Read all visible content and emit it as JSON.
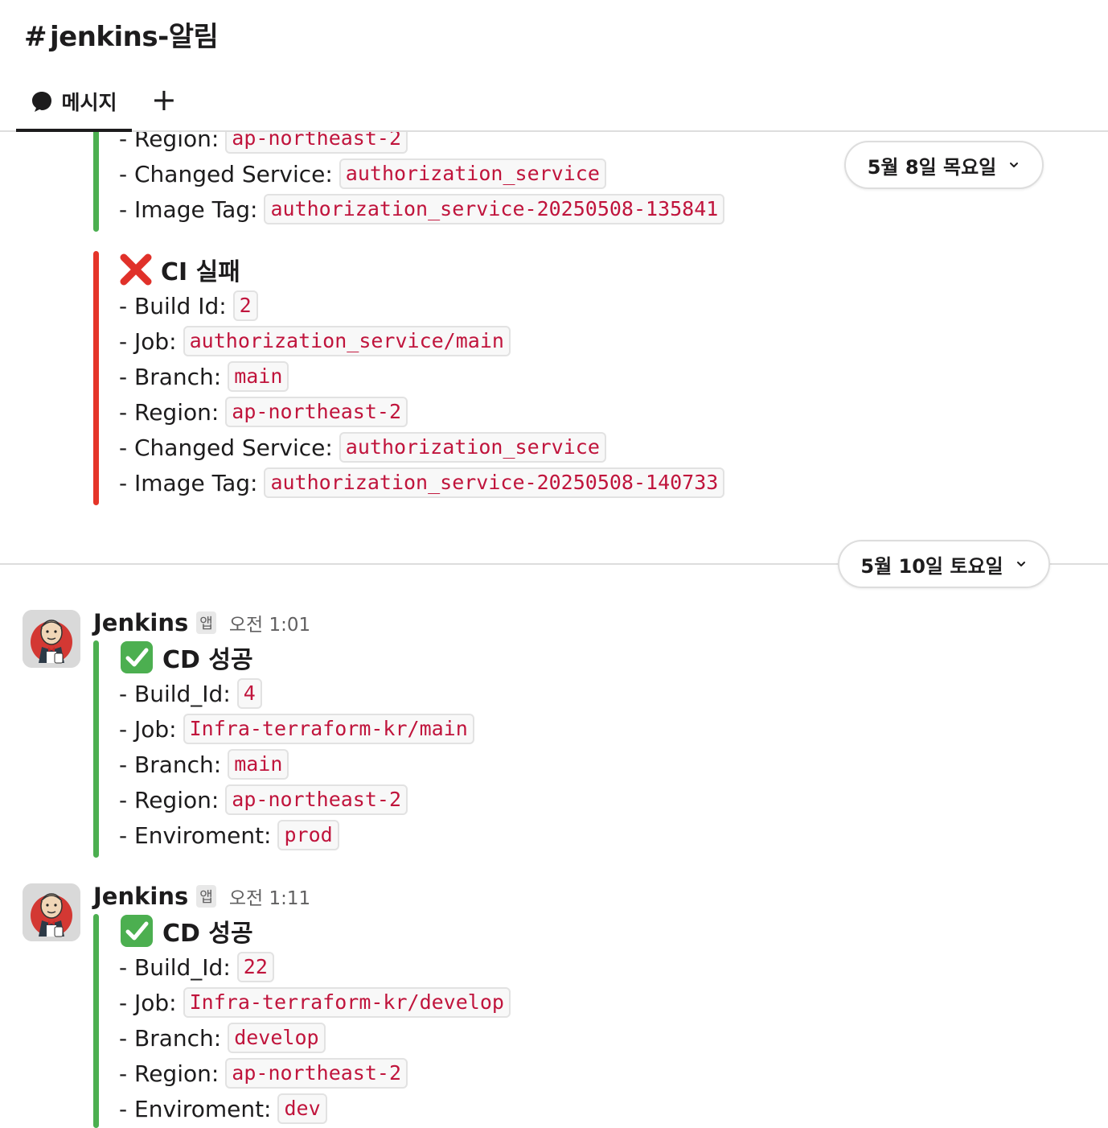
{
  "channel": {
    "hash": "#",
    "name": "jenkins-알림"
  },
  "tabs": {
    "messages_label": "메시지",
    "add_label": "+"
  },
  "date_pills": [
    {
      "label": "5월 8일 목요일"
    },
    {
      "label": "5월 10일 토요일"
    }
  ],
  "block1": {
    "fields": [
      {
        "label": "- Region:",
        "value": "ap-northeast-2"
      },
      {
        "label": "- Changed Service:",
        "value": "authorization_service"
      },
      {
        "label": "- Image Tag:",
        "value": "authorization_service-20250508-135841"
      }
    ]
  },
  "block2": {
    "title": "CI 실패",
    "fields": [
      {
        "label": "- Build Id:",
        "value": "2"
      },
      {
        "label": "- Job:",
        "value": "authorization_service/main"
      },
      {
        "label": "- Branch:",
        "value": "main"
      },
      {
        "label": "- Region:",
        "value": "ap-northeast-2"
      },
      {
        "label": "- Changed Service:",
        "value": "authorization_service"
      },
      {
        "label": "- Image Tag:",
        "value": "authorization_service-20250508-140733"
      }
    ]
  },
  "message1": {
    "sender": "Jenkins",
    "badge": "앱",
    "time": "오전 1:01",
    "title": "CD 성공",
    "fields": [
      {
        "label": "- Build_Id:",
        "value": "4"
      },
      {
        "label": "- Job:",
        "value": "Infra-terraform-kr/main"
      },
      {
        "label": "- Branch:",
        "value": "main"
      },
      {
        "label": "- Region:",
        "value": "ap-northeast-2"
      },
      {
        "label": "- Enviroment:",
        "value": "prod"
      }
    ]
  },
  "message2": {
    "sender": "Jenkins",
    "badge": "앱",
    "time": "오전 1:11",
    "title": "CD 성공",
    "fields": [
      {
        "label": "- Build_Id:",
        "value": "22"
      },
      {
        "label": "- Job:",
        "value": "Infra-terraform-kr/develop"
      },
      {
        "label": "- Branch:",
        "value": "develop"
      },
      {
        "label": "- Region:",
        "value": "ap-northeast-2"
      },
      {
        "label": "- Enviroment:",
        "value": "dev"
      }
    ]
  },
  "colors": {
    "success_bar": "#4caf50",
    "fail_bar": "#e53529",
    "code_text": "#c0143c"
  },
  "icons": {
    "fail": "cross-mark-icon",
    "success": "check-mark-icon",
    "tab": "chat-bubble-icon",
    "dropdown": "chevron-down-icon"
  }
}
